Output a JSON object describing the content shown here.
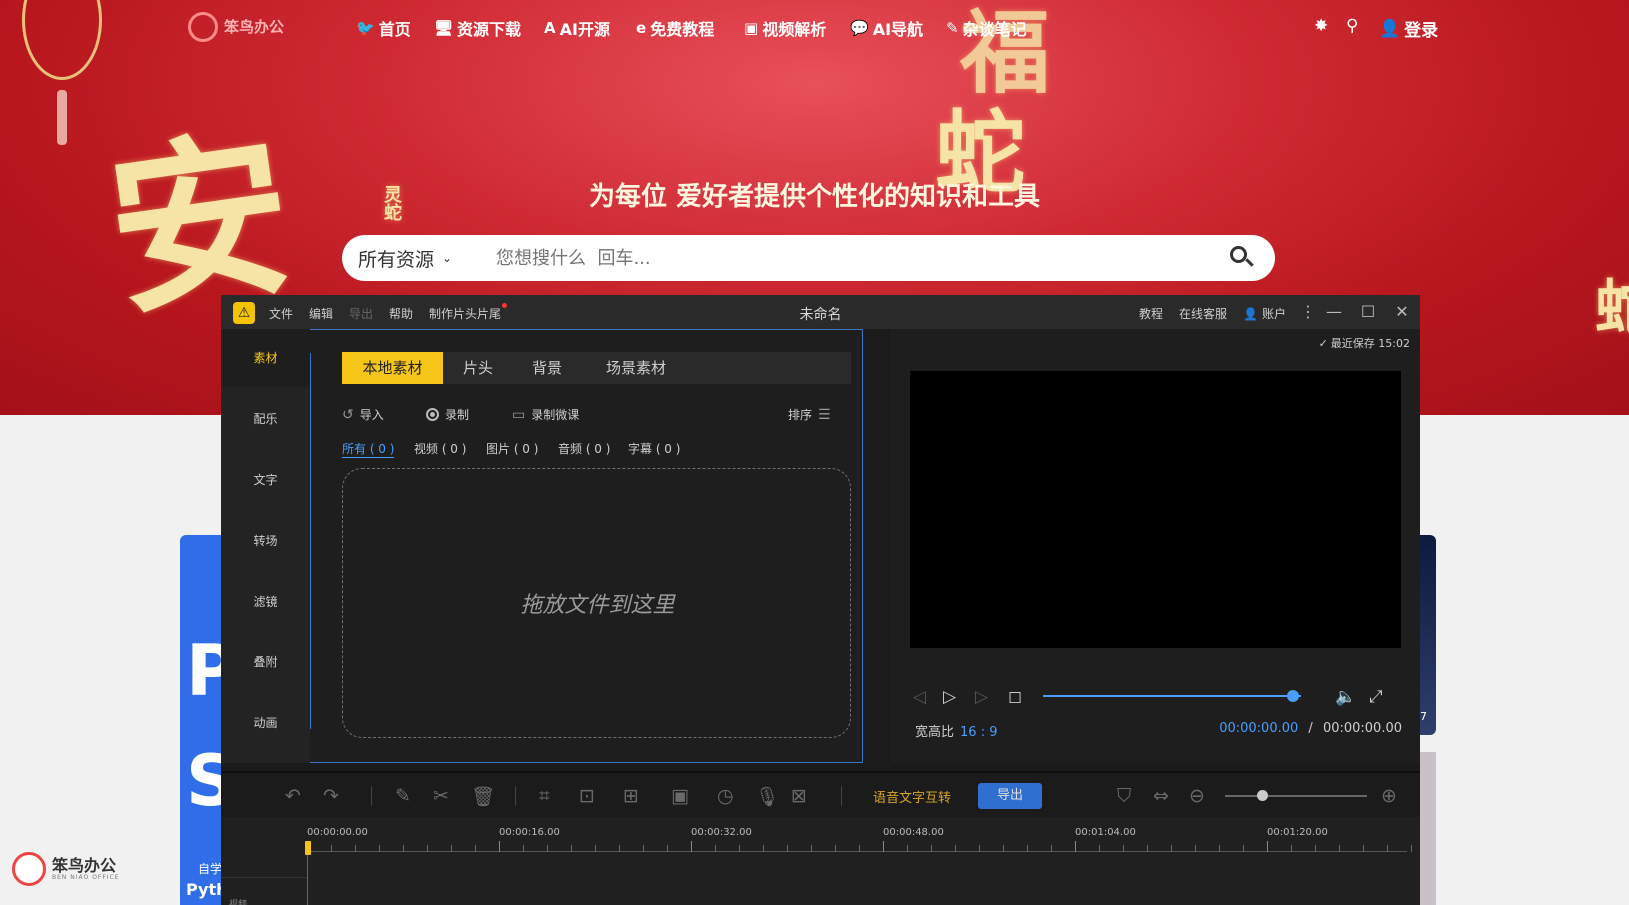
{
  "site": {
    "logo_text": "笨鸟办公",
    "nav": [
      {
        "icon": "bird-icon",
        "glyph": "🐦",
        "label": "首页"
      },
      {
        "icon": "monitor-icon",
        "glyph": "🖥",
        "label": "资源下载"
      },
      {
        "icon": "a-icon",
        "glyph": "A",
        "label": "AI开源"
      },
      {
        "icon": "edge-icon",
        "glyph": "e",
        "label": "免费教程"
      },
      {
        "icon": "play-icon",
        "glyph": "▣",
        "label": "视频解析"
      },
      {
        "icon": "chat-icon",
        "glyph": "💬",
        "label": "AI导航"
      },
      {
        "icon": "pen-icon",
        "glyph": "✎",
        "label": "杂谈笔记"
      }
    ],
    "login_label": "登录",
    "slogan": "为每位 爱好者提供个性化的知识和工具",
    "search": {
      "category": "所有资源",
      "placeholder": "您想搜什么  回车..."
    },
    "side_card_left": {
      "big_letter_1": "P",
      "big_letter_2": "S",
      "small_text": "自学",
      "small_text_2": "Pyth"
    },
    "side_card_right": {
      "text": "7"
    },
    "watermark": {
      "text": "笨鸟办公",
      "sub": "BEN NIAO OFFICE"
    },
    "decor": {
      "char_1": "安",
      "char_2": "蛇",
      "char_3": "福",
      "char_4": "灵蛇"
    }
  },
  "editor": {
    "window_title": "未命名",
    "menu": [
      "文件",
      "编辑",
      "导出",
      "帮助",
      "制作片头片尾"
    ],
    "menu_disabled": "导出",
    "top_right": {
      "tutorial": "教程",
      "support": "在线客服",
      "account": "账户"
    },
    "left_nav": [
      "素材",
      "配乐",
      "文字",
      "转场",
      "滤镜",
      "叠附",
      "动画"
    ],
    "tabs": [
      "本地素材",
      "片头",
      "背景",
      "场景素材"
    ],
    "toolbar": {
      "import": "导入",
      "record": "录制",
      "record_micro": "录制微课",
      "sort": "排序"
    },
    "filters": [
      "所有 ( 0 )",
      "视频 ( 0 )",
      "图片 ( 0 )",
      "音频 ( 0 )",
      "字幕 ( 0 )"
    ],
    "dropzone_text": "拖放文件到这里",
    "autosave": "最近保存 15:02",
    "aspect_label": "宽高比",
    "aspect_value": "16 : 9",
    "time_current": "00:00:00.00",
    "time_separator": "/",
    "time_total": "00:00:00.00",
    "progress_fraction": 0.97,
    "zoom_fraction": 0.26,
    "tts_label": "语音文字互转",
    "export_label": "导出",
    "ruler": [
      "00:00:00.00",
      "00:00:16.00",
      "00:00:32.00",
      "00:00:48.00",
      "00:01:04.00",
      "00:01:20.00"
    ],
    "track_label": "视频",
    "colors": {
      "accent": "#f5c518",
      "blue": "#4a9eff",
      "export_bg": "#2e6fd0",
      "hero_red": "#c81e27"
    }
  }
}
